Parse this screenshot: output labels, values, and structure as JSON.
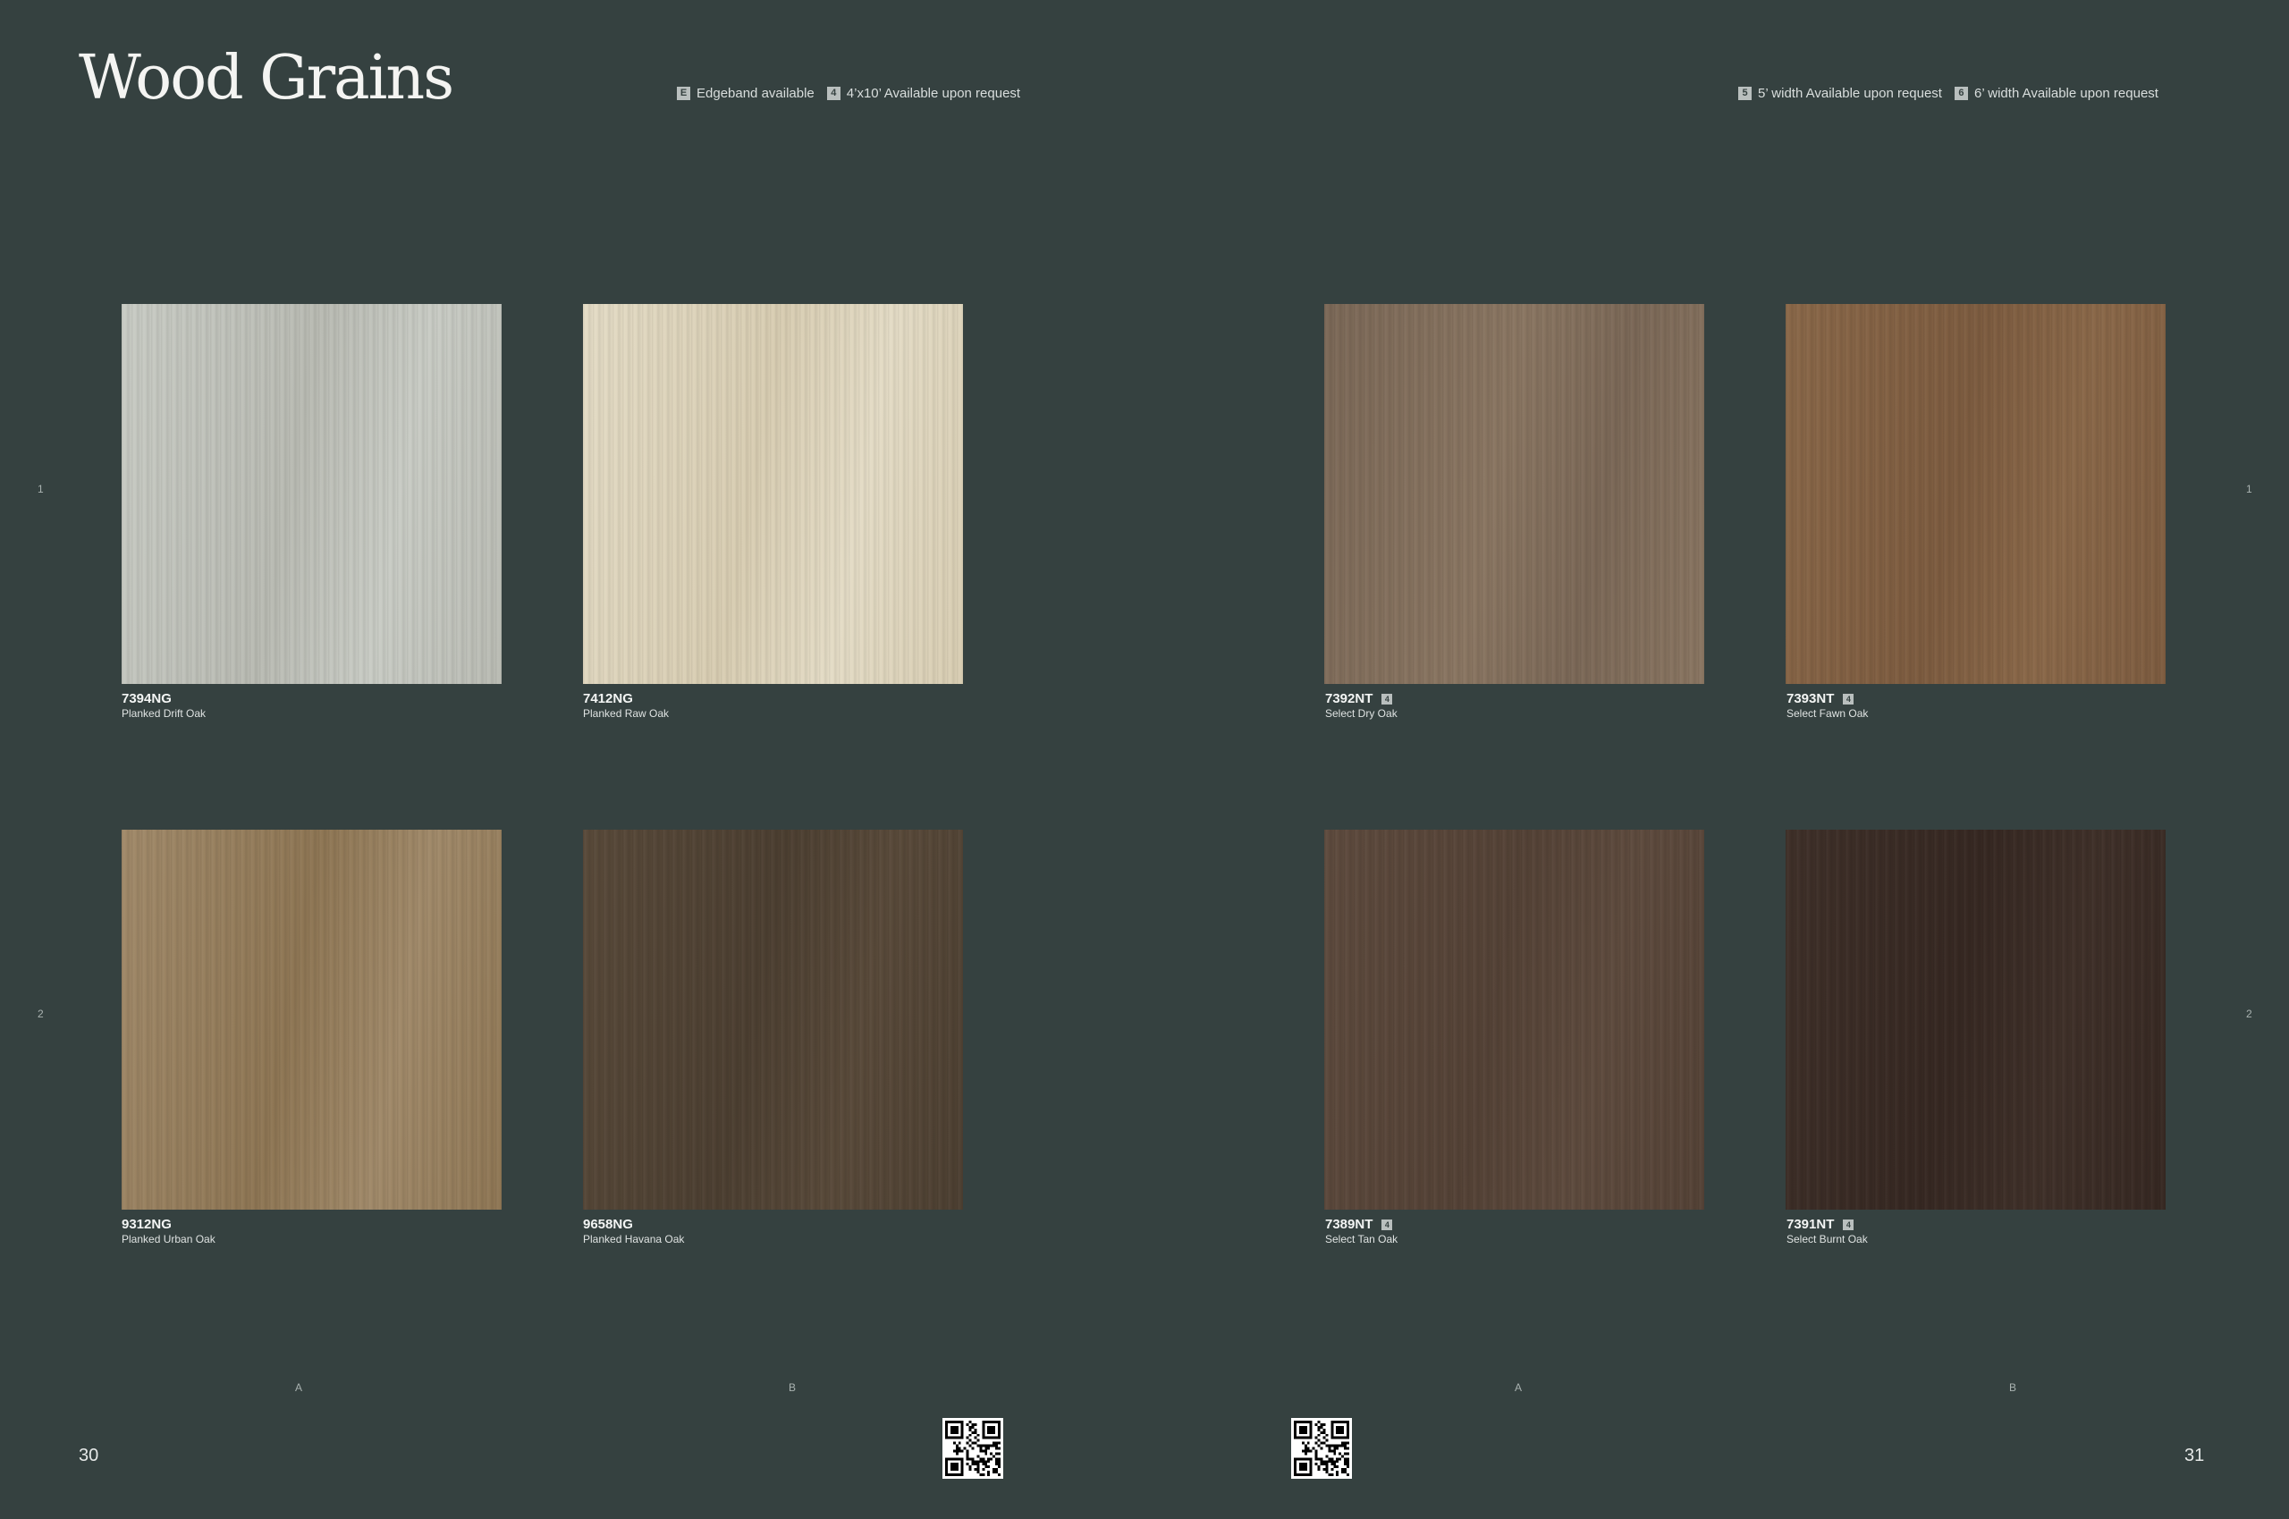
{
  "page": {
    "title": "Wood Grains",
    "left_page_number": "30",
    "right_page_number": "31"
  },
  "legend_left": [
    {
      "badge": "E",
      "label": "Edgeband available"
    },
    {
      "badge": "4",
      "label": "4’x10’ Available upon request"
    }
  ],
  "legend_right": [
    {
      "badge": "5",
      "label": "5’ width Available upon request"
    },
    {
      "badge": "6",
      "label": "6’ width Available upon request"
    }
  ],
  "row_markers": [
    "1",
    "2"
  ],
  "column_markers": [
    "A",
    "B",
    "A",
    "B"
  ],
  "swatches": [
    {
      "code": "7394NG",
      "name": "Planked Drift Oak",
      "badge": "",
      "color": "#c9ccc5",
      "color2": "#b9bbb3"
    },
    {
      "code": "7412NG",
      "name": "Planked Raw Oak",
      "badge": "",
      "color": "#e4dcc6",
      "color2": "#d8cdb2"
    },
    {
      "code": "7392NT",
      "name": "Select Dry Oak",
      "badge": "4",
      "color": "#7b6857",
      "color2": "#8a7662"
    },
    {
      "code": "7393NT",
      "name": "Select  Fawn Oak",
      "badge": "4",
      "color": "#8a6849",
      "color2": "#7d5c40"
    },
    {
      "code": "9312NG",
      "name": "Planked Urban Oak",
      "badge": "",
      "color": "#a18a6a",
      "color2": "#8e7654"
    },
    {
      "code": "9658NG",
      "name": "Planked Havana Oak",
      "badge": "",
      "color": "#594a3a",
      "color2": "#4c3f31"
    },
    {
      "code": "7389NT",
      "name": "Select Tan Oak",
      "badge": "4",
      "color": "#5e4b3e",
      "color2": "#544236"
    },
    {
      "code": "7391NT",
      "name": "Select Burnt Oak",
      "badge": "4",
      "color": "#3f3029",
      "color2": "#362822"
    }
  ]
}
